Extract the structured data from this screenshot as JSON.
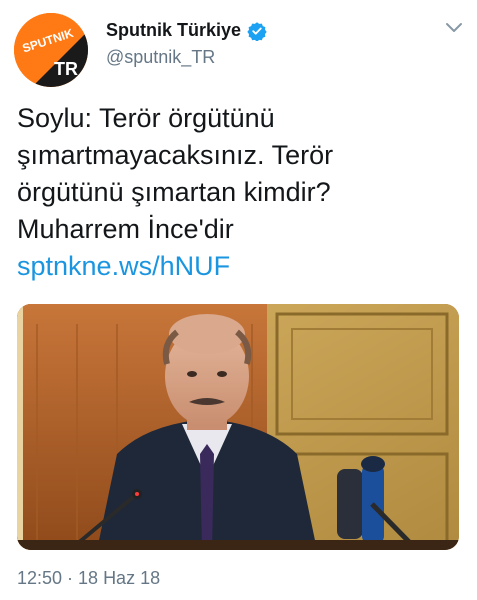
{
  "account": {
    "display_name": "Sputnik Türkiye",
    "handle": "@sputnik_TR",
    "verified": true,
    "avatar_logo": "SPUTNIK",
    "avatar_region": "TR"
  },
  "tweet": {
    "text_lines": [
      "Soylu: Terör örgütünü",
      "şımartmayacaksınız. Terör",
      "örgütünü şımartan kimdir?",
      "Muharrem İnce'dir"
    ],
    "link": "sptnkne.ws/hNUF",
    "timestamp": "12:50 · 18 Haz 18"
  },
  "colors": {
    "brand_orange": "#ff7a14",
    "link_blue": "#1b95e0",
    "verified_blue": "#1da1f2",
    "secondary_text": "#657786"
  },
  "icons": {
    "verified": "verified-badge-icon",
    "menu": "chevron-down-icon"
  }
}
